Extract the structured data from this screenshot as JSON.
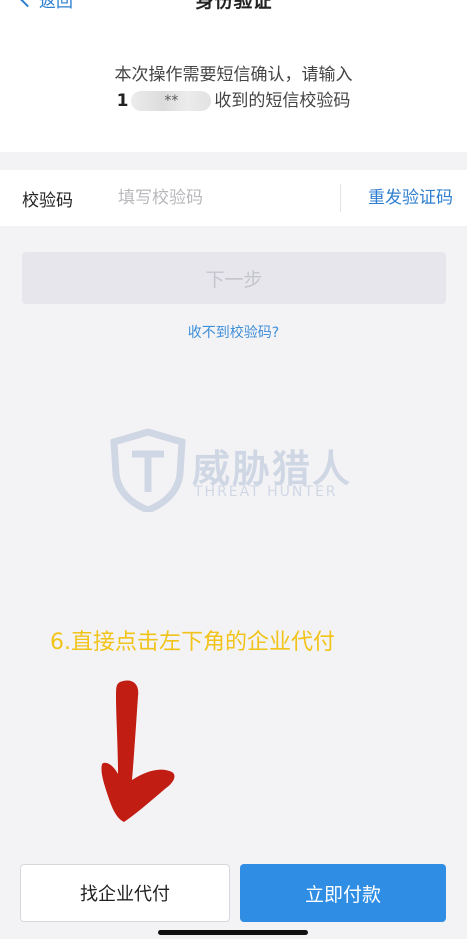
{
  "header": {
    "back_label": "返回",
    "title": "身份验证"
  },
  "sms_hint": {
    "line1": "本次操作需要短信确认，请输入",
    "phone_prefix": "1",
    "phone_masked": "**",
    "line2_suffix": "收到的短信校验码"
  },
  "code_field": {
    "label": "校验码",
    "placeholder": "填写校验码",
    "value": "",
    "resend_label": "重发验证码"
  },
  "next_button": {
    "label": "下一步",
    "enabled": false
  },
  "no_code_link": "收不到校验码?",
  "watermark": {
    "name_cn": "威胁猎人",
    "name_en": "THREAT HUNTER"
  },
  "annotation": {
    "text": "6.直接点击左下角的企业代付",
    "color": "#f2c318",
    "arrow_color": "#c21d12"
  },
  "bottom_bar": {
    "company_pay_label": "找企业代付",
    "pay_now_label": "立即付款",
    "accent": "#2f8de4"
  }
}
